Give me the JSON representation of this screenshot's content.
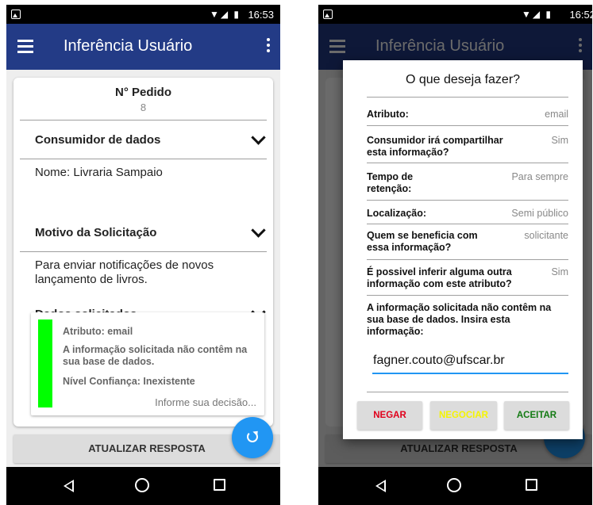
{
  "status": {
    "time_left": "16:53",
    "time_right": "16:52"
  },
  "appbar": {
    "title": "Inferência Usuário"
  },
  "order": {
    "label": "N° Pedido",
    "value": "8"
  },
  "sections": {
    "consumer": {
      "title": "Consumidor de dados",
      "body": "Nome: Livraria Sampaio"
    },
    "reason": {
      "title": "Motivo da Solicitação",
      "body": "Para enviar notificações de novos lançamento de livros."
    },
    "requested": {
      "title": "Dados solicitados"
    }
  },
  "requested_item": {
    "attribute": "Atributo: email",
    "message": "A informação solicitada não contêm na sua base de dados.",
    "confidence": "Nível Confiança: Inexistente",
    "hint": "Informe sua decisão...",
    "indicator_color": "#00ff00"
  },
  "update_button": "ATUALIZAR RESPOSTA",
  "dialog": {
    "title": "O que deseja fazer?",
    "rows": [
      {
        "key": "Atributo:",
        "value": "email"
      },
      {
        "key": "Consumidor irá compartilhar esta informação?",
        "value": "Sim"
      },
      {
        "key": "Tempo de retenção:",
        "value": "Para sempre"
      },
      {
        "key": "Localização:",
        "value": "Semi público"
      },
      {
        "key": "Quem se beneficia com essa informação?",
        "value": "solicitante"
      },
      {
        "key": "É possivel inferir alguma outra informação com este atributo?",
        "value": "Sim"
      }
    ],
    "notice": "A informação solicitada não contêm na sua base de dados. Insira esta informação:",
    "input_value": "fagner.couto@ufscar.br",
    "buttons": {
      "deny": "NEGAR",
      "negotiate": "NEGOCIAR",
      "accept": "ACEITAR"
    }
  },
  "colors": {
    "appbar": "#233b86",
    "fab": "#2196f3",
    "deny": "#e0001b",
    "negotiate": "#f5f500",
    "accept": "#127a12"
  }
}
